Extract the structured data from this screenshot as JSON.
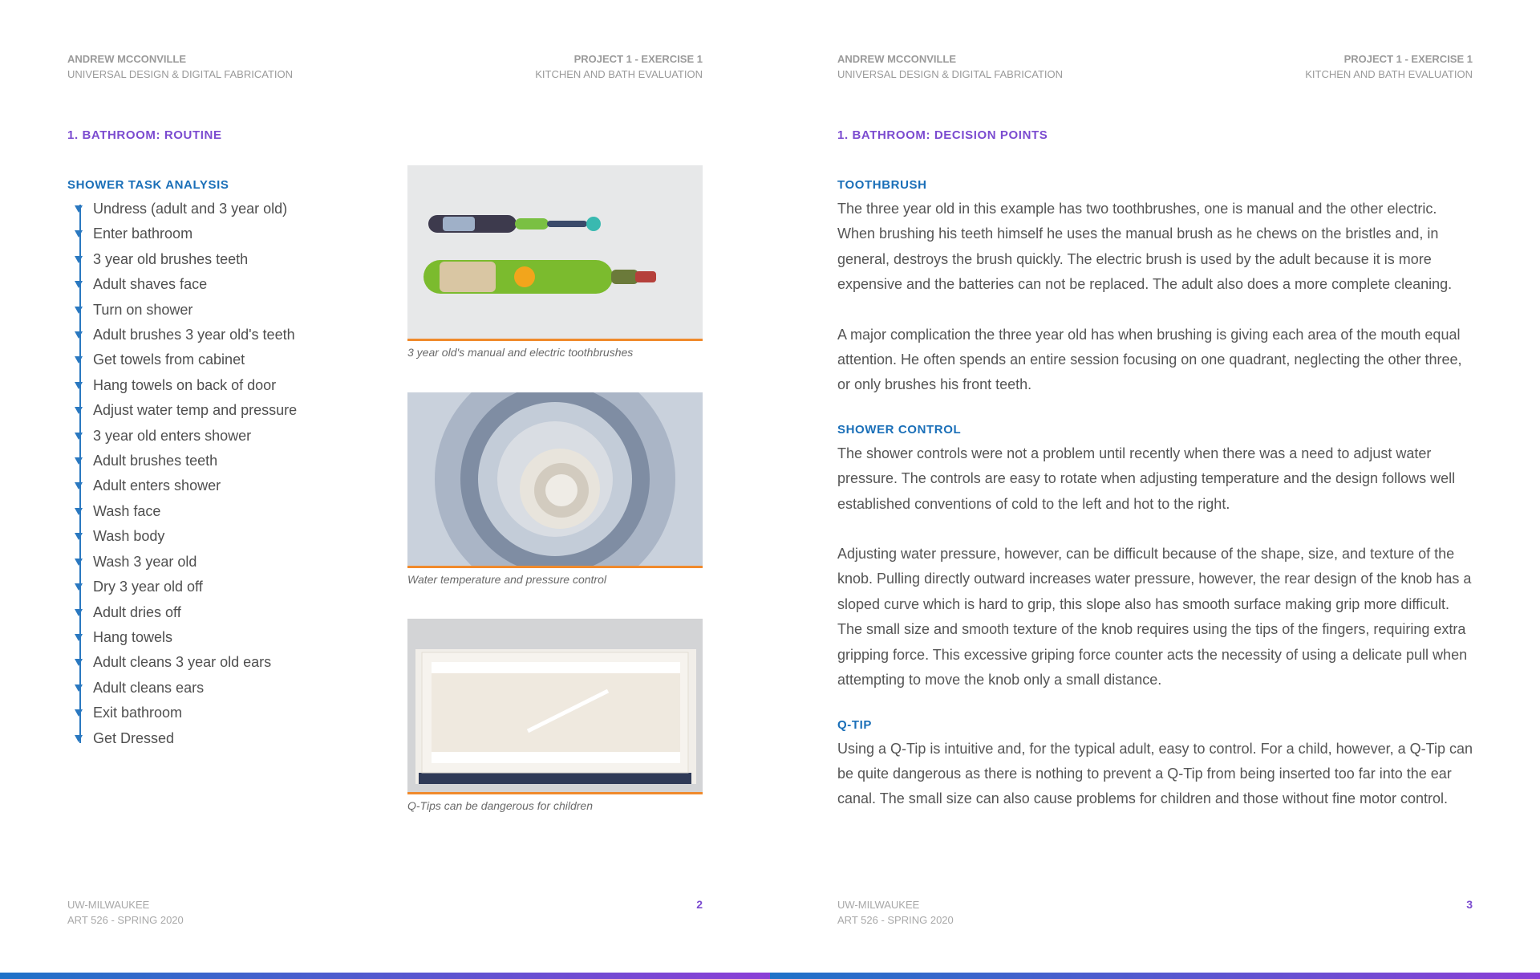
{
  "left_page": {
    "header": {
      "author": "ANDREW MCCONVILLE",
      "course": "UNIVERSAL DESIGN & DIGITAL FABRICATION",
      "project": "PROJECT 1 - EXERCISE 1",
      "evaluation": "KITCHEN AND BATH EVALUATION"
    },
    "section_title": "1. BATHROOM: ROUTINE",
    "subheading": "SHOWER TASK ANALYSIS",
    "tasks": [
      "Undress (adult and 3 year old)",
      "Enter bathroom",
      "3 year old brushes teeth",
      "Adult shaves face",
      "Turn on shower",
      "Adult brushes 3 year old's teeth",
      "Get towels from cabinet",
      "Hang towels on back of door",
      "Adjust water temp and pressure",
      "3 year old enters shower",
      "Adult brushes teeth",
      "Adult enters shower",
      "Wash face",
      "Wash body",
      "Wash 3 year old",
      "Dry 3 year old off",
      "Adult dries off",
      "Hang towels",
      "Adult cleans 3 year old ears",
      "Adult cleans ears",
      "Exit bathroom",
      "Get Dressed"
    ],
    "figures": [
      {
        "caption": "3 year old's manual and electric toothbrushes"
      },
      {
        "caption": "Water temperature and pressure control"
      },
      {
        "caption": "Q-Tips can be dangerous for children"
      }
    ],
    "footer": {
      "school": "UW-MILWAUKEE",
      "course": "ART 526 - SPRING 2020"
    },
    "page_number": "2"
  },
  "right_page": {
    "header": {
      "author": "ANDREW MCCONVILLE",
      "course": "UNIVERSAL DESIGN & DIGITAL FABRICATION",
      "project": "PROJECT 1 - EXERCISE 1",
      "evaluation": "KITCHEN AND BATH EVALUATION"
    },
    "section_title": "1. BATHROOM: DECISION POINTS",
    "toothbrush": {
      "heading": "TOOTHBRUSH",
      "p1": "The three year old in this example has two toothbrushes, one is manual and the other electric. When brushing his teeth himself he uses the manual brush as he chews on the bristles and, in general, destroys the brush quickly. The electric brush is used by the adult because it is more expensive and the batteries can not be replaced. The adult also does a more complete cleaning.",
      "p2": "A major complication the three year old has when brushing is giving each area of the mouth equal attention. He often spends an entire session focusing on one quadrant, neglecting the other three, or only brushes his front teeth."
    },
    "shower_control": {
      "heading": "SHOWER CONTROL",
      "p1": "The shower controls were not a problem until recently when there was a need to adjust water pressure. The controls are easy to rotate when adjusting temperature and the design follows well established conventions of cold to the left and hot to the right.",
      "p2": "Adjusting water pressure, however, can be difficult because of the shape, size, and texture of the knob. Pulling directly outward increases water pressure, however, the rear design of the knob has a sloped curve which is hard to grip, this slope also has smooth surface making grip more difficult. The small size and smooth texture of the knob requires using the tips of the fingers, requiring extra gripping force. This excessive griping force counter acts the necessity of using a delicate pull when attempting to move the knob only a small distance."
    },
    "qtip": {
      "heading": "Q-TIP",
      "p1": "Using a Q-Tip is intuitive and, for the typical adult, easy to control. For a child, however, a Q-Tip can be quite dangerous as there is nothing to prevent a Q-Tip from being inserted too far into the ear canal. The small size can also cause problems for children and those without fine motor control."
    },
    "footer": {
      "school": "UW-MILWAUKEE",
      "course": "ART 526 - SPRING 2020"
    },
    "page_number": "3"
  },
  "colors": {
    "accent_purple": "#7b4bd0",
    "accent_blue": "#1a6fb8",
    "caption_rule": "#f08a2c"
  }
}
